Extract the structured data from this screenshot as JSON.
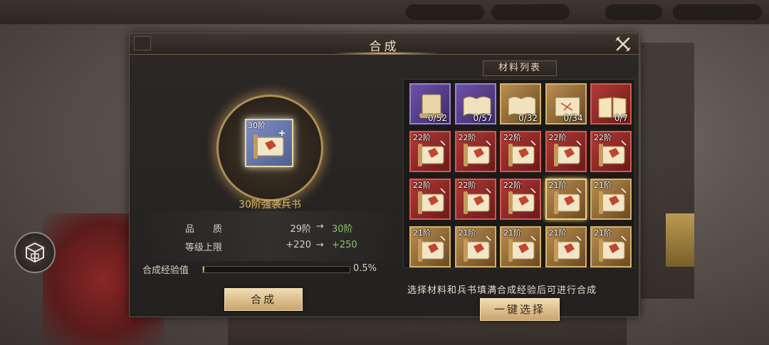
{
  "dialog": {
    "title": "合成",
    "left": {
      "item_tier": "30阶",
      "item_name": "30阶强袭兵书",
      "stats": [
        {
          "label": "品　　质",
          "from": "29阶",
          "arrow": "→",
          "to": "30阶"
        },
        {
          "label": "等级上限",
          "from": "+220",
          "arrow": "→",
          "to": "+250"
        }
      ],
      "exp_label": "合成经验值",
      "exp_value": "0.5%",
      "exp_fraction": 0.005,
      "compose_button": "合成"
    },
    "right": {
      "tab_label": "材料列表",
      "materials": [
        {
          "tier": "",
          "count": "0/52",
          "rarity": "purple",
          "icon": "scroll-closed-icon"
        },
        {
          "tier": "",
          "count": "0/57",
          "rarity": "purple",
          "icon": "scroll-open-icon"
        },
        {
          "tier": "",
          "count": "0/32",
          "rarity": "gold",
          "icon": "scroll-open-icon"
        },
        {
          "tier": "",
          "count": "0/34",
          "rarity": "gold",
          "icon": "scroll-map-icon"
        },
        {
          "tier": "",
          "count": "0/7",
          "rarity": "red",
          "icon": "book-open-icon"
        },
        {
          "tier": "22阶",
          "count": "",
          "rarity": "red",
          "icon": "war-book-icon"
        },
        {
          "tier": "22阶",
          "count": "",
          "rarity": "red",
          "icon": "war-book-icon"
        },
        {
          "tier": "22阶",
          "count": "",
          "rarity": "red",
          "icon": "war-book-icon"
        },
        {
          "tier": "22阶",
          "count": "",
          "rarity": "red",
          "icon": "war-book-icon"
        },
        {
          "tier": "22阶",
          "count": "",
          "rarity": "red",
          "icon": "war-book-icon"
        },
        {
          "tier": "22阶",
          "count": "",
          "rarity": "red",
          "icon": "war-book-icon"
        },
        {
          "tier": "22阶",
          "count": "",
          "rarity": "red",
          "icon": "war-book-icon"
        },
        {
          "tier": "22阶",
          "count": "",
          "rarity": "red",
          "icon": "war-book-icon"
        },
        {
          "tier": "21阶",
          "count": "",
          "rarity": "gold-selected",
          "icon": "war-book-icon"
        },
        {
          "tier": "21阶",
          "count": "",
          "rarity": "gold",
          "icon": "war-book-icon"
        },
        {
          "tier": "21阶",
          "count": "",
          "rarity": "gold",
          "icon": "war-book-icon"
        },
        {
          "tier": "21阶",
          "count": "",
          "rarity": "gold",
          "icon": "war-book-icon"
        },
        {
          "tier": "21阶",
          "count": "",
          "rarity": "gold",
          "icon": "war-book-icon"
        },
        {
          "tier": "21阶",
          "count": "",
          "rarity": "gold",
          "icon": "war-book-icon"
        },
        {
          "tier": "21阶",
          "count": "",
          "rarity": "gold",
          "icon": "war-book-icon"
        }
      ],
      "hint": "选择材料和兵书填满合成经验后可进行合成",
      "auto_select_button": "一键选择"
    }
  }
}
